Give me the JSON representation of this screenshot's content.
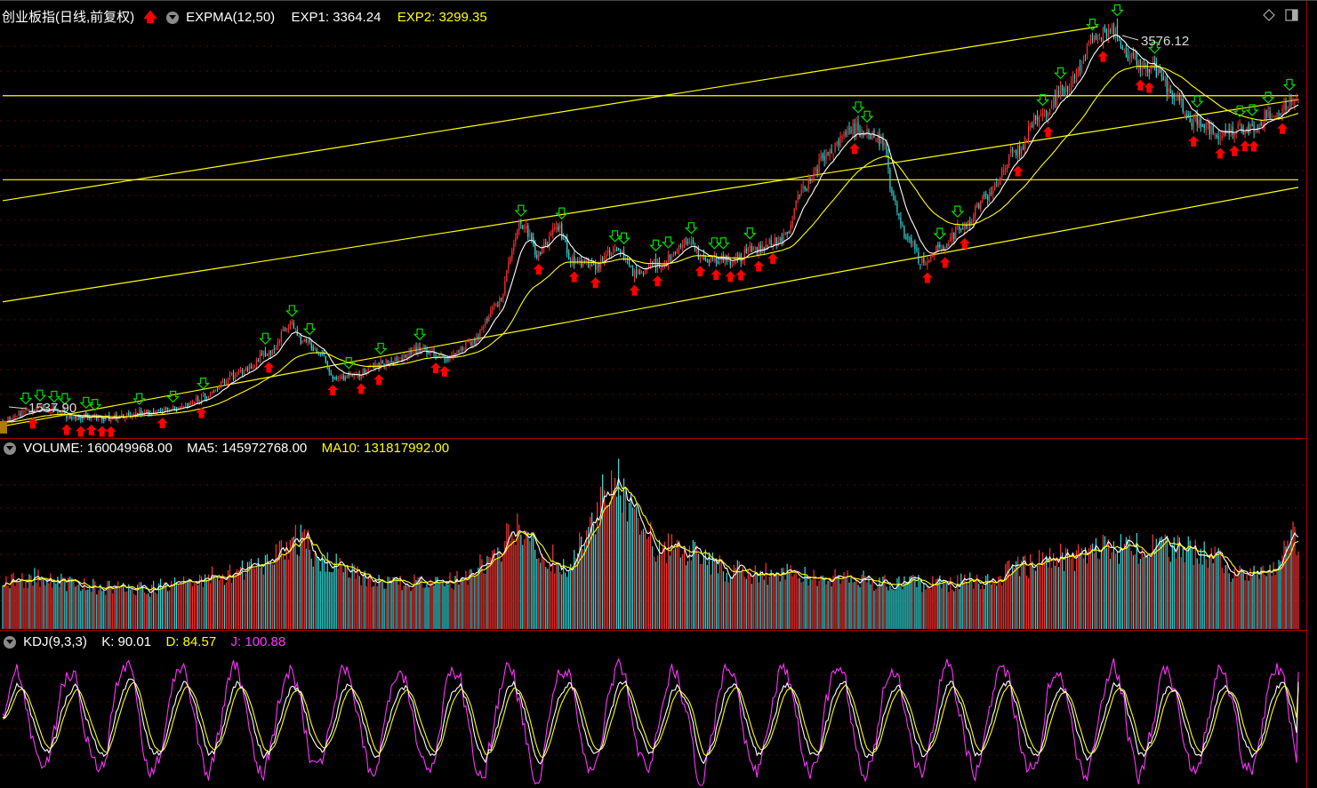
{
  "main_panel": {
    "title": "创业板指(日线,前复权)",
    "indicator": "EXPMA(12,50)",
    "exp1_label": "EXP1: 3364.24",
    "exp2_label": "EXP2: 3299.35",
    "high_label": "3576.12",
    "low_label": "1537.90"
  },
  "volume_panel": {
    "volume_label": "VOLUME: 160049968.00",
    "ma5_label": "MA5: 145972768.00",
    "ma10_label": "MA10: 131817992.00"
  },
  "kdj_panel": {
    "indicator": "KDJ(9,3,3)",
    "k_label": "K: 90.01",
    "d_label": "D: 84.57",
    "j_label": "J: 100.88"
  },
  "colors": {
    "up": "#ff3333",
    "down": "#33dddd",
    "exp1": "#ffffff",
    "exp2": "#ffff00",
    "trendline": "#ffff00",
    "k": "#ffffff",
    "d": "#ffff00",
    "j": "#ff33ff",
    "sell_arrow": "#00dd00",
    "buy_arrow": "#ff0000",
    "grid": "#660000"
  },
  "chart_data": [
    {
      "type": "candlestick",
      "x_order": "chronological",
      "y_range": [
        1480,
        3640
      ],
      "grid": true,
      "anchors": [
        {
          "x": 0,
          "y": 1537.9
        },
        {
          "x": 12,
          "y": 1590
        },
        {
          "x": 25,
          "y": 1610
        },
        {
          "x": 40,
          "y": 1570
        },
        {
          "x": 60,
          "y": 1560
        },
        {
          "x": 80,
          "y": 1590
        },
        {
          "x": 100,
          "y": 1610
        },
        {
          "x": 115,
          "y": 1680
        },
        {
          "x": 130,
          "y": 1780
        },
        {
          "x": 150,
          "y": 1900
        },
        {
          "x": 162,
          "y": 2050
        },
        {
          "x": 170,
          "y": 1960
        },
        {
          "x": 180,
          "y": 1880
        },
        {
          "x": 188,
          "y": 1760
        },
        {
          "x": 198,
          "y": 1780
        },
        {
          "x": 215,
          "y": 1850
        },
        {
          "x": 235,
          "y": 1920
        },
        {
          "x": 250,
          "y": 1880
        },
        {
          "x": 265,
          "y": 1960
        },
        {
          "x": 278,
          "y": 2150
        },
        {
          "x": 292,
          "y": 2580
        },
        {
          "x": 302,
          "y": 2420
        },
        {
          "x": 312,
          "y": 2560
        },
        {
          "x": 322,
          "y": 2380
        },
        {
          "x": 335,
          "y": 2360
        },
        {
          "x": 345,
          "y": 2450
        },
        {
          "x": 357,
          "y": 2320
        },
        {
          "x": 370,
          "y": 2370
        },
        {
          "x": 385,
          "y": 2480
        },
        {
          "x": 395,
          "y": 2400
        },
        {
          "x": 410,
          "y": 2380
        },
        {
          "x": 425,
          "y": 2450
        },
        {
          "x": 440,
          "y": 2500
        },
        {
          "x": 452,
          "y": 2780
        },
        {
          "x": 465,
          "y": 2950
        },
        {
          "x": 478,
          "y": 3080
        },
        {
          "x": 488,
          "y": 3050
        },
        {
          "x": 496,
          "y": 3000
        },
        {
          "x": 502,
          "y": 2700
        },
        {
          "x": 510,
          "y": 2500
        },
        {
          "x": 518,
          "y": 2380
        },
        {
          "x": 528,
          "y": 2450
        },
        {
          "x": 540,
          "y": 2550
        },
        {
          "x": 555,
          "y": 2720
        },
        {
          "x": 570,
          "y": 2950
        },
        {
          "x": 585,
          "y": 3150
        },
        {
          "x": 600,
          "y": 3300
        },
        {
          "x": 615,
          "y": 3550
        },
        {
          "x": 625,
          "y": 3600
        },
        {
          "x": 635,
          "y": 3450
        },
        {
          "x": 648,
          "y": 3390
        },
        {
          "x": 660,
          "y": 3250
        },
        {
          "x": 672,
          "y": 3110
        },
        {
          "x": 685,
          "y": 3050
        },
        {
          "x": 700,
          "y": 3070
        },
        {
          "x": 715,
          "y": 3150
        },
        {
          "x": 730,
          "y": 3250
        }
      ],
      "overlays": [
        {
          "name": "EXP1",
          "period": 12
        },
        {
          "name": "EXP2",
          "period": 50
        }
      ],
      "trendlines_price": [
        {
          "x1": 0,
          "y1": 2700,
          "x2": 617,
          "y2": 3612
        },
        {
          "x1": 0,
          "y1": 2170,
          "x2": 730,
          "y2": 3230
        },
        {
          "x1": 0,
          "y1": 1518,
          "x2": 730,
          "y2": 2770
        },
        {
          "x1": 0,
          "y1": 3250,
          "x2": 730,
          "y2": 3250
        },
        {
          "x1": 0,
          "y1": 2810,
          "x2": 730,
          "y2": 2810
        }
      ],
      "extremes": {
        "high": 3576.12,
        "low": 1537.9
      }
    },
    {
      "type": "bar",
      "series": [
        {
          "name": "VOLUME"
        },
        {
          "name": "MA5",
          "period": 5
        },
        {
          "name": "MA10",
          "period": 10
        }
      ],
      "y_range": [
        0,
        290000000
      ],
      "vol_anchors": [
        {
          "x": 0,
          "y": 80000000
        },
        {
          "x": 20,
          "y": 90000000
        },
        {
          "x": 45,
          "y": 75000000
        },
        {
          "x": 80,
          "y": 70000000
        },
        {
          "x": 105,
          "y": 80000000
        },
        {
          "x": 125,
          "y": 95000000
        },
        {
          "x": 145,
          "y": 110000000
        },
        {
          "x": 165,
          "y": 155000000
        },
        {
          "x": 185,
          "y": 115000000
        },
        {
          "x": 205,
          "y": 90000000
        },
        {
          "x": 230,
          "y": 80000000
        },
        {
          "x": 255,
          "y": 85000000
        },
        {
          "x": 275,
          "y": 120000000
        },
        {
          "x": 288,
          "y": 170000000
        },
        {
          "x": 300,
          "y": 140000000
        },
        {
          "x": 318,
          "y": 110000000
        },
        {
          "x": 332,
          "y": 190000000
        },
        {
          "x": 345,
          "y": 270000000
        },
        {
          "x": 357,
          "y": 200000000
        },
        {
          "x": 370,
          "y": 140000000
        },
        {
          "x": 390,
          "y": 130000000
        },
        {
          "x": 410,
          "y": 100000000
        },
        {
          "x": 440,
          "y": 95000000
        },
        {
          "x": 470,
          "y": 90000000
        },
        {
          "x": 500,
          "y": 80000000
        },
        {
          "x": 530,
          "y": 78000000
        },
        {
          "x": 555,
          "y": 85000000
        },
        {
          "x": 575,
          "y": 110000000
        },
        {
          "x": 600,
          "y": 125000000
        },
        {
          "x": 625,
          "y": 140000000
        },
        {
          "x": 650,
          "y": 140000000
        },
        {
          "x": 675,
          "y": 135000000
        },
        {
          "x": 695,
          "y": 100000000
        },
        {
          "x": 712,
          "y": 95000000
        },
        {
          "x": 730,
          "y": 160000000
        }
      ]
    },
    {
      "type": "line",
      "series": [
        {
          "name": "K"
        },
        {
          "name": "D"
        },
        {
          "name": "J"
        }
      ],
      "y_range": [
        -20,
        120
      ],
      "cycle_days": 33,
      "last_values": {
        "K": 90.01,
        "D": 84.57,
        "J": 100.88
      }
    }
  ]
}
